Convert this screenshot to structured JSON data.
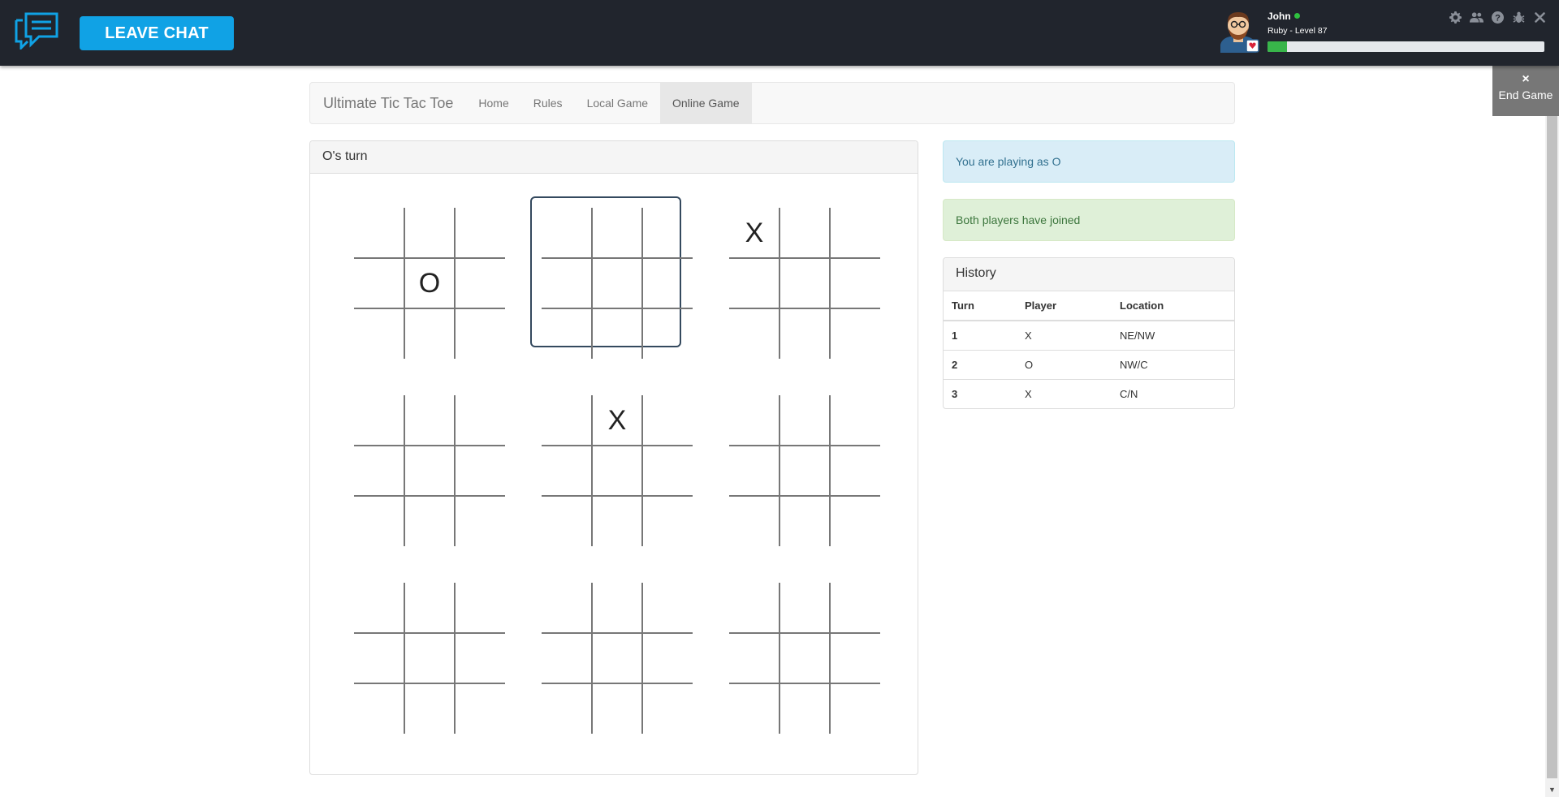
{
  "topbar": {
    "leave_label": "LEAVE CHAT",
    "user_name": "John",
    "user_level": "Ruby - Level 87",
    "xp_percent": 7,
    "icons": [
      "gear-icon",
      "users-icon",
      "help-icon",
      "bug-icon",
      "close-icon"
    ]
  },
  "end_game": {
    "x": "×",
    "label": "End Game"
  },
  "nav": {
    "brand": "Ultimate Tic Tac Toe",
    "links": [
      "Home",
      "Rules",
      "Local Game",
      "Online Game"
    ],
    "active": "Online Game"
  },
  "board": {
    "status": "O's turn",
    "active_board": "N",
    "moves": [
      {
        "board": "NE",
        "cell": "NW",
        "mark": "X"
      },
      {
        "board": "NW",
        "cell": "C",
        "mark": "O"
      },
      {
        "board": "C",
        "cell": "N",
        "mark": "X"
      }
    ]
  },
  "alerts": {
    "playing_as": "You are playing as O",
    "joined": "Both players have joined"
  },
  "history": {
    "title": "History",
    "columns": [
      "Turn",
      "Player",
      "Location"
    ],
    "rows": [
      {
        "turn": "1",
        "player": "X",
        "location": "NE/NW"
      },
      {
        "turn": "2",
        "player": "O",
        "location": "NW/C"
      },
      {
        "turn": "3",
        "player": "X",
        "location": "C/N"
      }
    ]
  },
  "colors": {
    "topbar_bg": "#21252d",
    "leave_btn": "#10a2e5",
    "xp_fill": "#38b54a",
    "active_board_border": "#34495e"
  }
}
